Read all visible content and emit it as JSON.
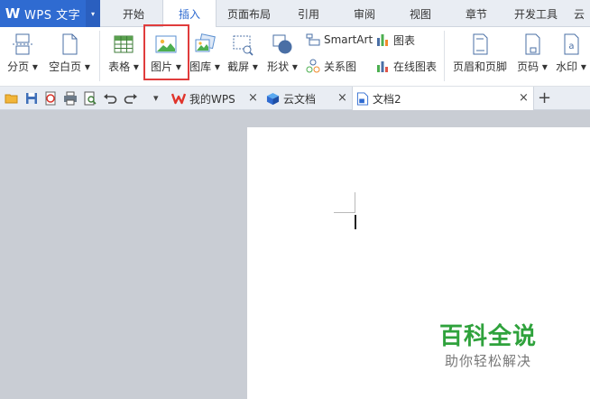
{
  "app": {
    "logo_text": "W",
    "name": "WPS 文字",
    "dropdown_arrow": "▾"
  },
  "menu_tabs": [
    {
      "label": "开始"
    },
    {
      "label": "插入"
    },
    {
      "label": "页面布局"
    },
    {
      "label": "引用"
    },
    {
      "label": "审阅"
    },
    {
      "label": "视图"
    },
    {
      "label": "章节"
    },
    {
      "label": "开发工具"
    },
    {
      "label": "云"
    }
  ],
  "active_menu_tab": "插入",
  "ribbon": {
    "page_break": "分页 ▾",
    "blank_page": "空白页 ▾",
    "table": "表格 ▾",
    "picture": "图片 ▾",
    "gallery": "图库 ▾",
    "screenshot": "截屏 ▾",
    "shapes": "形状 ▾",
    "smartart": "SmartArt",
    "relation": "关系图",
    "chart": "图表",
    "online_chart": "在线图表",
    "header_footer": "页眉和页脚",
    "page_number": "页码 ▾",
    "watermark": "水印 ▾"
  },
  "doc_tabs": [
    {
      "label": "我的WPS",
      "close": "×"
    },
    {
      "label": "云文档",
      "close": "×"
    },
    {
      "label": "文档2",
      "close": "×"
    }
  ],
  "new_tab": "+",
  "tab_list_arrow": "▾",
  "watermark_brand": {
    "title": "百科全说",
    "subtitle": "助你轻松解决"
  },
  "colors": {
    "accent": "#2f6bd1",
    "highlight": "#e03c3c",
    "brand_green": "#2fa23c"
  }
}
